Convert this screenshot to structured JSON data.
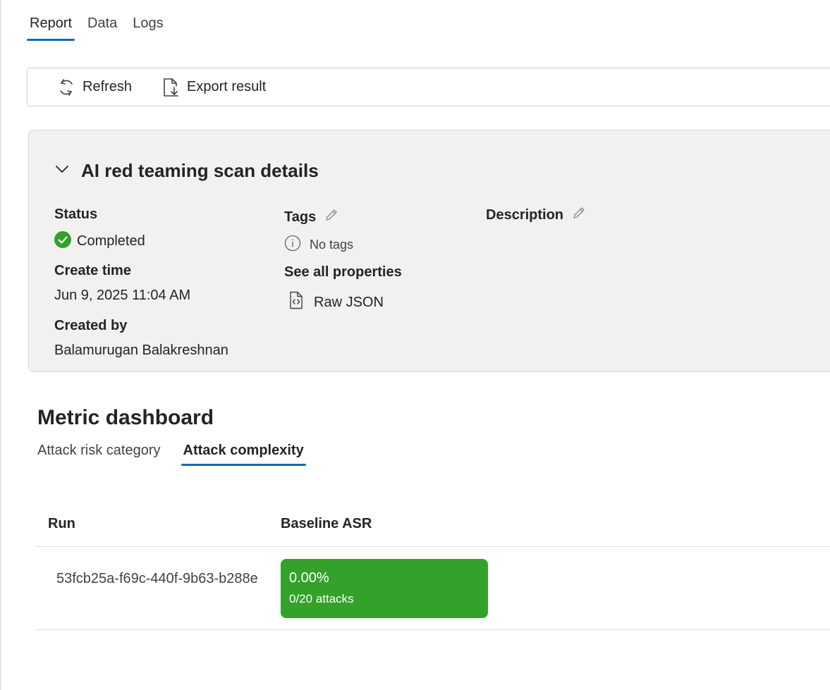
{
  "tabs": [
    "Report",
    "Data",
    "Logs"
  ],
  "toolbar": {
    "refresh_label": "Refresh",
    "export_label": "Export result"
  },
  "details": {
    "title": "AI red teaming scan details",
    "status_label": "Status",
    "status_value": "Completed",
    "create_time_label": "Create time",
    "create_time_value": "Jun 9, 2025 11:04 AM",
    "created_by_label": "Created by",
    "created_by_value": "Balamurugan Balakreshnan",
    "tags_label": "Tags",
    "tags_value": "No tags",
    "properties_label": "See all properties",
    "raw_json_label": "Raw JSON",
    "description_label": "Description"
  },
  "metric": {
    "title": "Metric dashboard",
    "tabs": [
      "Attack risk category",
      "Attack complexity"
    ],
    "table": {
      "headers": {
        "run": "Run",
        "baseline": "Baseline ASR"
      },
      "rows": [
        {
          "run": "53fcb25a-f69c-440f-9b63-b288e",
          "asr": "0.00%",
          "attacks": "0/20 attacks"
        }
      ]
    }
  },
  "colors": {
    "accent": "#0f6cbd",
    "success": "#33a12a",
    "card_bg": "#f2f1f0"
  }
}
